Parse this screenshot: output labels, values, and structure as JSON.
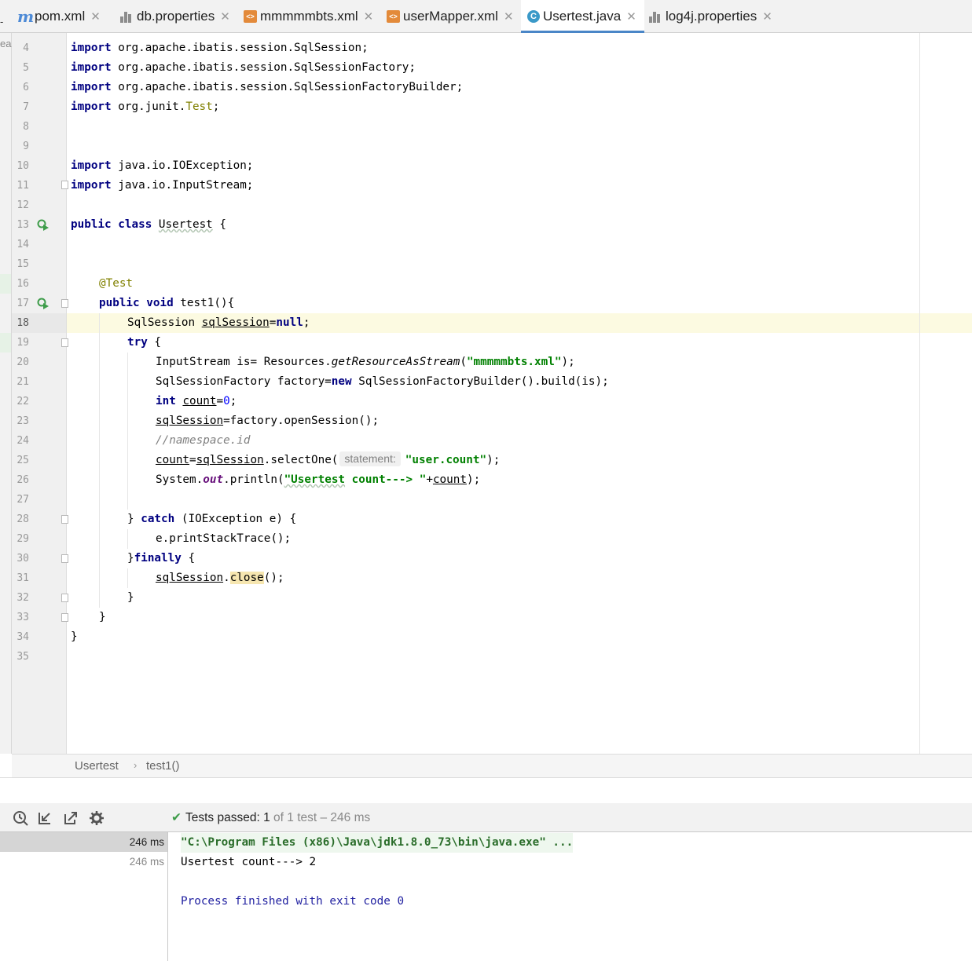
{
  "tabs": [
    {
      "label": "pom.xml",
      "icon": "maven-icon",
      "active": false
    },
    {
      "label": "db.properties",
      "icon": "properties-file-icon",
      "active": false
    },
    {
      "label": "mmmmmbts.xml",
      "icon": "xml-file-icon",
      "active": false
    },
    {
      "label": "userMapper.xml",
      "icon": "xml-file-icon",
      "active": false
    },
    {
      "label": "Usertest.java",
      "icon": "java-class-icon",
      "active": true
    },
    {
      "label": "log4j.properties",
      "icon": "properties-file-icon",
      "active": false
    }
  ],
  "left_strip": {
    "fragment": "ea",
    "dash": "-"
  },
  "editor": {
    "line_numbers": [
      "4",
      "5",
      "6",
      "7",
      "8",
      "9",
      "10",
      "11",
      "12",
      "13",
      "14",
      "15",
      "16",
      "17",
      "18",
      "19",
      "20",
      "21",
      "22",
      "23",
      "24",
      "25",
      "26",
      "27",
      "28",
      "29",
      "30",
      "31",
      "32",
      "33",
      "34",
      "35"
    ],
    "current_line": "18",
    "code": {
      "l4_kw": "import",
      "l4_rest": " org.apache.ibatis.session.SqlSession;",
      "l5_kw": "import",
      "l5_rest": " org.apache.ibatis.session.SqlSessionFactory;",
      "l6_kw": "import",
      "l6_rest": " org.apache.ibatis.session.SqlSessionFactoryBuilder;",
      "l7_kw": "import",
      "l7_a": " org.junit.",
      "l7_b": "Test",
      "l7_c": ";",
      "l10_kw": "import",
      "l10_rest": " java.io.IOException;",
      "l11_kw": "import",
      "l11_rest": " java.io.InputStream;",
      "l13_kw1": "public",
      "l13_kw2": "class",
      "l13_name": "Usertest",
      "l13_rest": " {",
      "l16_ann": "@Test",
      "l17_kw1": "public",
      "l17_kw2": "void",
      "l17_rest": " test1(){",
      "l18_a": "SqlSession ",
      "l18_var": "sqlSession",
      "l18_b": "=",
      "l18_kw": "null",
      "l18_c": ";",
      "l19_kw": "try",
      "l19_rest": " {",
      "l20_a": "InputStream is= Resources.",
      "l20_m": "getResourceAsStream",
      "l20_b": "(",
      "l20_s": "\"mmmmmbts.xml\"",
      "l20_c": ");",
      "l21_a": "SqlSessionFactory factory=",
      "l21_kw": "new",
      "l21_b": " SqlSessionFactoryBuilder().build(is);",
      "l22_kw": "int",
      "l22_var": "count",
      "l22_b": "=",
      "l22_num": "0",
      "l22_c": ";",
      "l23_var": "sqlSession",
      "l23_rest": "=factory.openSession();",
      "l24_cmt": "//namespace.id",
      "l25_var1": "count",
      "l25_a": "=",
      "l25_var2": "sqlSession",
      "l25_b": ".selectOne(",
      "l25_hint": "statement:",
      "l25_s": "\"user.count\"",
      "l25_c": ");",
      "l26_a": "System.",
      "l26_out": "out",
      "l26_b": ".println(",
      "l26_s1": "\"Usertest",
      "l26_s2": " count---> \"",
      "l26_c": "+",
      "l26_var": "count",
      "l26_d": ");",
      "l28_a": "} ",
      "l28_kw": "catch",
      "l28_rest": " (IOException e) {",
      "l29_rest": "e.printStackTrace();",
      "l30_a": "}",
      "l30_kw": "finally",
      "l30_rest": " {",
      "l31_var": "sqlSession",
      "l31_a": ".",
      "l31_hl": "close",
      "l31_b": "();",
      "l32": "}",
      "l33": "}",
      "l34": "}"
    }
  },
  "breadcrumb": {
    "class": "Usertest",
    "separator": "›",
    "method": "test1()"
  },
  "run": {
    "toolbar": [
      "history-icon",
      "import-tests-icon",
      "export-tests-icon",
      "settings-gear-icon"
    ],
    "status_label": "Tests passed:",
    "status_count": "1",
    "status_rest": "of 1 test – 246 ms",
    "tree_rows": [
      "246 ms",
      "246 ms"
    ],
    "console": {
      "cmd": "\"C:\\Program Files (x86)\\Java\\jdk1.8.0_73\\bin\\java.exe\" ...",
      "output": "Usertest count---> 2",
      "exit": "Process finished with exit code 0"
    }
  },
  "colors": {
    "keyword": "#000080",
    "string": "#008000",
    "number": "#0000ff",
    "annotation": "#808000",
    "comment": "#808080",
    "active_tab_underline": "#4a86c7",
    "pass_green": "#3e9c4a"
  }
}
